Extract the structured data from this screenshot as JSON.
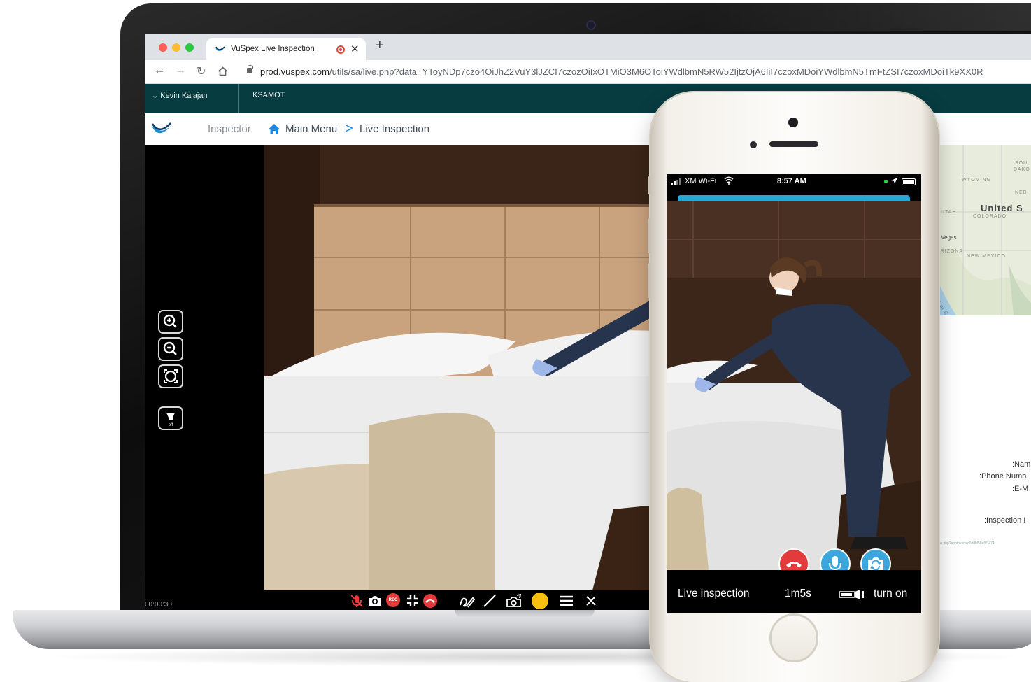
{
  "browser": {
    "tab_title": "VuSpex Live Inspection",
    "url_host": "prod.vuspex.com",
    "url_path": "/utils/sa/live.php?data=YToyNDp7czo4OiJhZ2VuY3lJZCI7czozOiIxOTMiO3M6OToiYWdlbmN5RW52IjtzOjA6IiI7czoxMDoiYWdlbmN5TmFtZSI7czoxMDoiTk9XX0R"
  },
  "app": {
    "user_name": "Kevin Kalajan",
    "company": "KSAMOT",
    "breadcrumb": {
      "root": "Inspector",
      "main": "Main Menu",
      "separator": ">",
      "current": "Live Inspection"
    }
  },
  "desktop_call": {
    "timer": "00:00:30",
    "rec_label": "REC",
    "torch_off_label": "off",
    "brush_color": "#f9c00d",
    "end_call_color": "#e33b3b"
  },
  "side_panel": {
    "map": {
      "labels": [
        "SOU",
        "DAKO",
        "WYOMING",
        "NEB",
        "United S",
        "UTAH",
        "COLORADO",
        "s Vegas",
        "ARIZONA",
        "NEW MEXICO",
        "Gulf of Calif"
      ],
      "bold": "United S"
    },
    "fields": [
      ":Nam",
      ":Phone Numb",
      ":E-M",
      ":Inspection I"
    ],
    "link_text": "tion.php?apptoken=c0ddbf58e8f1474"
  },
  "phone": {
    "carrier": "XM Wi-Fi",
    "time": "8:57 AM",
    "progress": 1.0,
    "live_label": "Live inspection",
    "elapsed": "1m5s",
    "torch_label": "turn on"
  }
}
